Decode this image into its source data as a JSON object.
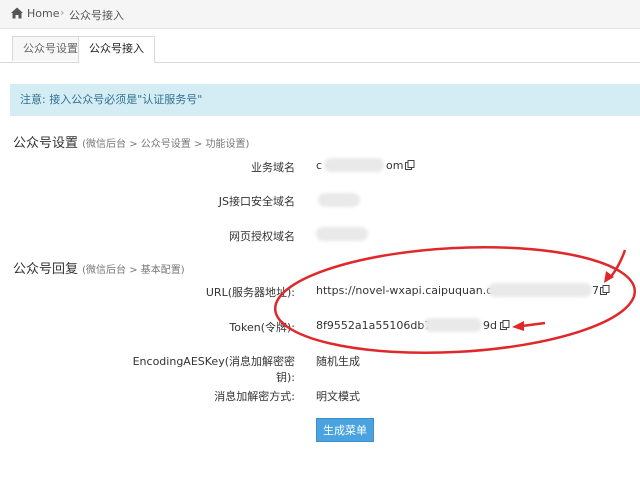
{
  "breadcrumb": {
    "home": "Home",
    "current": "公众号接入"
  },
  "tabs": [
    {
      "label": "公众号设置",
      "active": false
    },
    {
      "label": "公众号接入",
      "active": true
    }
  ],
  "notice": "注意: 接入公众号必须是\"认证服务号\"",
  "section1": {
    "title": "公众号设置",
    "subtitle": "(微信后台 > 公众号设置 > 功能设置)",
    "rows": [
      {
        "label": "业务域名",
        "value_start": "c",
        "value_end": "om"
      },
      {
        "label": "JS接口安全域名"
      },
      {
        "label": "网页授权域名"
      }
    ]
  },
  "section2": {
    "title": "公众号回复",
    "subtitle": "(微信后台 > 基本配置)",
    "rows": [
      {
        "label": "URL(服务器地址):",
        "value_start": "https://novel-wxapi.caipuquan.com",
        "value_end": "7"
      },
      {
        "label": "Token(令牌):",
        "value_start": "8f9552a1a55106db7c",
        "value_end": "9d"
      },
      {
        "label": "EncodingAESKey(消息加解密密钥):",
        "value": "随机生成"
      },
      {
        "label": "消息加解密方式:",
        "value": "明文模式"
      }
    ]
  },
  "button_label": "生成菜单",
  "colors": {
    "accent": "#4aa3df",
    "notice_bg": "#d4edf5",
    "annotation_red": "#e0282a"
  },
  "icons": [
    "home-icon",
    "copy-icon"
  ]
}
